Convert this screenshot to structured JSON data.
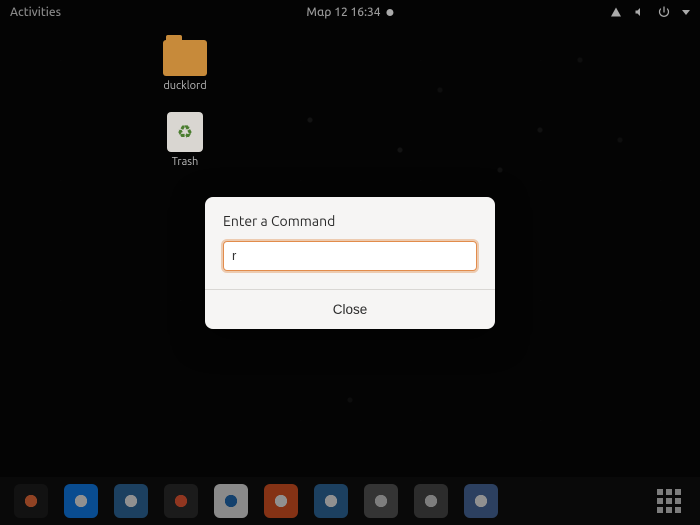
{
  "topbar": {
    "activities_label": "Activities",
    "clock_text": "Μαρ 12  16:34",
    "status_icons": [
      "network-icon",
      "volume-icon",
      "power-icon",
      "chevron-down-icon"
    ]
  },
  "desktop": {
    "icons": [
      {
        "name": "home-folder-icon",
        "label": "ducklord",
        "kind": "folder"
      },
      {
        "name": "trash-icon",
        "label": "Trash",
        "kind": "trash"
      }
    ]
  },
  "run_dialog": {
    "title": "Enter a Command",
    "input_value": "r",
    "close_label": "Close",
    "accent_color": "#e28c4c"
  },
  "dock": {
    "items": [
      {
        "name": "firefox-icon",
        "bg": "#1a1a1a",
        "glyph_color": "#ff7139"
      },
      {
        "name": "thunderbird-icon",
        "bg": "#0a84ff",
        "glyph_color": "#fff"
      },
      {
        "name": "files-icon",
        "bg": "#2d6ea8",
        "glyph_color": "#fff"
      },
      {
        "name": "rhythmbox-icon",
        "bg": "#2b2b2b",
        "glyph_color": "#ff5c33"
      },
      {
        "name": "libreoffice-writer-icon",
        "bg": "#f5f5f5",
        "glyph_color": "#1e6fbf"
      },
      {
        "name": "ubuntu-software-icon",
        "bg": "#e95420",
        "glyph_color": "#fff"
      },
      {
        "name": "help-icon",
        "bg": "#2d6ea8",
        "glyph_color": "#fff"
      },
      {
        "name": "settings-icon",
        "bg": "#585858",
        "glyph_color": "#ddd"
      },
      {
        "name": "software-updater-icon",
        "bg": "#4a4a4a",
        "glyph_color": "#ddd"
      },
      {
        "name": "screenshot-icon",
        "bg": "#4a6ea8",
        "glyph_color": "#fff"
      }
    ],
    "apps_grid_name": "show-applications-icon"
  }
}
